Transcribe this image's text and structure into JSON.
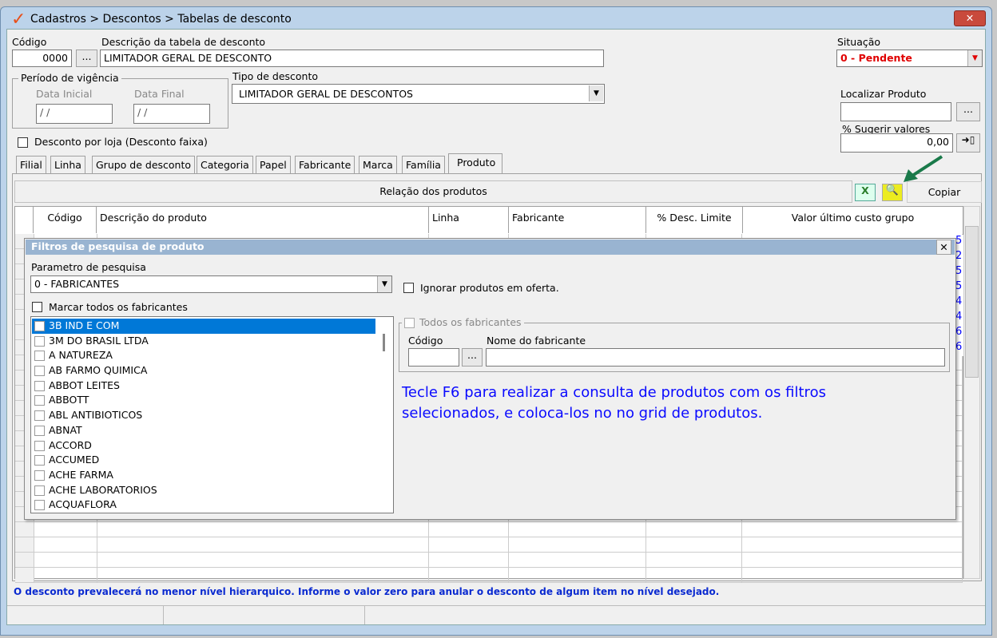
{
  "title": "Cadastros > Descontos > Tabelas de desconto",
  "codigo": {
    "label": "Código",
    "value": "0000",
    "browse": "..."
  },
  "descricao": {
    "label": "Descrição da tabela de desconto",
    "value": "LIMITADOR GERAL DE DESCONTO"
  },
  "situacao": {
    "label": "Situação",
    "value": "0 - Pendente",
    "color": "#e00000"
  },
  "periodo": {
    "label": "Período de vigência",
    "inicial_label": "Data Inicial",
    "inicial": " /  /",
    "final_label": "Data Final",
    "final": " /  /"
  },
  "tipo": {
    "label": "Tipo de desconto",
    "value": "LIMITADOR GERAL DE DESCONTOS"
  },
  "localizar": {
    "label": "Localizar Produto",
    "browse": "..."
  },
  "sugerir": {
    "label": "% Sugerir valores",
    "value": "0,00"
  },
  "desconto_loja": "Desconto por loja (Desconto faixa)",
  "tabs": [
    "Filial",
    "Linha",
    "Grupo de desconto",
    "Categoria",
    "Papel",
    "Fabricante",
    "Marca",
    "Família",
    "Produto"
  ],
  "relacao": "Relação dos produtos",
  "copiar": "Copiar",
  "columns": [
    "Código",
    "Descrição do produto",
    "Linha",
    "Fabricante",
    "% Desc. Limite",
    "Valor último custo grupo"
  ],
  "side_digits": [
    "5",
    "2",
    "5",
    "5",
    "4",
    "4",
    "6",
    "6"
  ],
  "dialog": {
    "title": "Filtros de pesquisa de produto",
    "param_label": "Parametro de pesquisa",
    "param_value": "0 - FABRICANTES",
    "ignorar": "Ignorar produtos em oferta.",
    "marcar": "Marcar todos os fabricantes",
    "todos": "Todos os fabricantes",
    "codigo_label": "Código",
    "nome_label": "Nome do fabricante",
    "browse": "...",
    "items": [
      "3B IND E COM",
      "3M DO BRASIL LTDA",
      "A NATUREZA",
      "AB FARMO QUIMICA",
      "ABBOT LEITES",
      "ABBOTT",
      "ABL ANTIBIOTICOS",
      "ABNAT",
      "ACCORD",
      "ACCUMED",
      "ACHE FARMA",
      "ACHE LABORATORIOS",
      "ACQUAFLORA"
    ],
    "hint": "Tecle F6 para realizar a consulta de produtos com os filtros selecionados, e coloca-los no no grid de produtos."
  },
  "footer": "O desconto prevalecerá no menor nível hierarquico. Informe o valor zero para anular o desconto de algum item no nível desejado."
}
